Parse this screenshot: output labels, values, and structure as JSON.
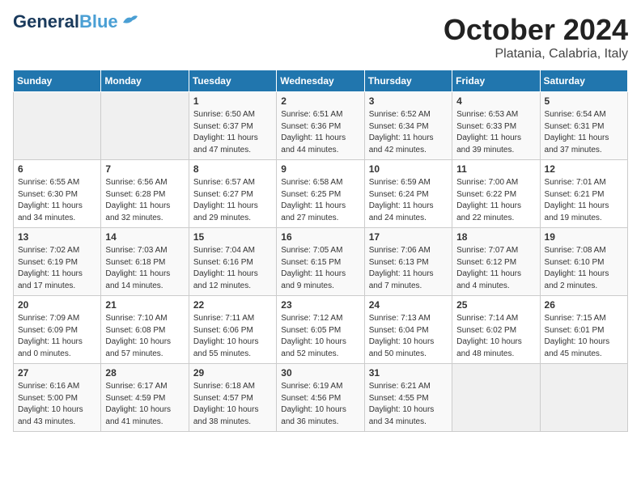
{
  "header": {
    "logo_general": "General",
    "logo_blue": "Blue",
    "month": "October 2024",
    "location": "Platania, Calabria, Italy"
  },
  "days_of_week": [
    "Sunday",
    "Monday",
    "Tuesday",
    "Wednesday",
    "Thursday",
    "Friday",
    "Saturday"
  ],
  "weeks": [
    [
      {
        "day": "",
        "info": ""
      },
      {
        "day": "",
        "info": ""
      },
      {
        "day": "1",
        "info": "Sunrise: 6:50 AM\nSunset: 6:37 PM\nDaylight: 11 hours\nand 47 minutes."
      },
      {
        "day": "2",
        "info": "Sunrise: 6:51 AM\nSunset: 6:36 PM\nDaylight: 11 hours\nand 44 minutes."
      },
      {
        "day": "3",
        "info": "Sunrise: 6:52 AM\nSunset: 6:34 PM\nDaylight: 11 hours\nand 42 minutes."
      },
      {
        "day": "4",
        "info": "Sunrise: 6:53 AM\nSunset: 6:33 PM\nDaylight: 11 hours\nand 39 minutes."
      },
      {
        "day": "5",
        "info": "Sunrise: 6:54 AM\nSunset: 6:31 PM\nDaylight: 11 hours\nand 37 minutes."
      }
    ],
    [
      {
        "day": "6",
        "info": "Sunrise: 6:55 AM\nSunset: 6:30 PM\nDaylight: 11 hours\nand 34 minutes."
      },
      {
        "day": "7",
        "info": "Sunrise: 6:56 AM\nSunset: 6:28 PM\nDaylight: 11 hours\nand 32 minutes."
      },
      {
        "day": "8",
        "info": "Sunrise: 6:57 AM\nSunset: 6:27 PM\nDaylight: 11 hours\nand 29 minutes."
      },
      {
        "day": "9",
        "info": "Sunrise: 6:58 AM\nSunset: 6:25 PM\nDaylight: 11 hours\nand 27 minutes."
      },
      {
        "day": "10",
        "info": "Sunrise: 6:59 AM\nSunset: 6:24 PM\nDaylight: 11 hours\nand 24 minutes."
      },
      {
        "day": "11",
        "info": "Sunrise: 7:00 AM\nSunset: 6:22 PM\nDaylight: 11 hours\nand 22 minutes."
      },
      {
        "day": "12",
        "info": "Sunrise: 7:01 AM\nSunset: 6:21 PM\nDaylight: 11 hours\nand 19 minutes."
      }
    ],
    [
      {
        "day": "13",
        "info": "Sunrise: 7:02 AM\nSunset: 6:19 PM\nDaylight: 11 hours\nand 17 minutes."
      },
      {
        "day": "14",
        "info": "Sunrise: 7:03 AM\nSunset: 6:18 PM\nDaylight: 11 hours\nand 14 minutes."
      },
      {
        "day": "15",
        "info": "Sunrise: 7:04 AM\nSunset: 6:16 PM\nDaylight: 11 hours\nand 12 minutes."
      },
      {
        "day": "16",
        "info": "Sunrise: 7:05 AM\nSunset: 6:15 PM\nDaylight: 11 hours\nand 9 minutes."
      },
      {
        "day": "17",
        "info": "Sunrise: 7:06 AM\nSunset: 6:13 PM\nDaylight: 11 hours\nand 7 minutes."
      },
      {
        "day": "18",
        "info": "Sunrise: 7:07 AM\nSunset: 6:12 PM\nDaylight: 11 hours\nand 4 minutes."
      },
      {
        "day": "19",
        "info": "Sunrise: 7:08 AM\nSunset: 6:10 PM\nDaylight: 11 hours\nand 2 minutes."
      }
    ],
    [
      {
        "day": "20",
        "info": "Sunrise: 7:09 AM\nSunset: 6:09 PM\nDaylight: 11 hours\nand 0 minutes."
      },
      {
        "day": "21",
        "info": "Sunrise: 7:10 AM\nSunset: 6:08 PM\nDaylight: 10 hours\nand 57 minutes."
      },
      {
        "day": "22",
        "info": "Sunrise: 7:11 AM\nSunset: 6:06 PM\nDaylight: 10 hours\nand 55 minutes."
      },
      {
        "day": "23",
        "info": "Sunrise: 7:12 AM\nSunset: 6:05 PM\nDaylight: 10 hours\nand 52 minutes."
      },
      {
        "day": "24",
        "info": "Sunrise: 7:13 AM\nSunset: 6:04 PM\nDaylight: 10 hours\nand 50 minutes."
      },
      {
        "day": "25",
        "info": "Sunrise: 7:14 AM\nSunset: 6:02 PM\nDaylight: 10 hours\nand 48 minutes."
      },
      {
        "day": "26",
        "info": "Sunrise: 7:15 AM\nSunset: 6:01 PM\nDaylight: 10 hours\nand 45 minutes."
      }
    ],
    [
      {
        "day": "27",
        "info": "Sunrise: 6:16 AM\nSunset: 5:00 PM\nDaylight: 10 hours\nand 43 minutes."
      },
      {
        "day": "28",
        "info": "Sunrise: 6:17 AM\nSunset: 4:59 PM\nDaylight: 10 hours\nand 41 minutes."
      },
      {
        "day": "29",
        "info": "Sunrise: 6:18 AM\nSunset: 4:57 PM\nDaylight: 10 hours\nand 38 minutes."
      },
      {
        "day": "30",
        "info": "Sunrise: 6:19 AM\nSunset: 4:56 PM\nDaylight: 10 hours\nand 36 minutes."
      },
      {
        "day": "31",
        "info": "Sunrise: 6:21 AM\nSunset: 4:55 PM\nDaylight: 10 hours\nand 34 minutes."
      },
      {
        "day": "",
        "info": ""
      },
      {
        "day": "",
        "info": ""
      }
    ]
  ]
}
